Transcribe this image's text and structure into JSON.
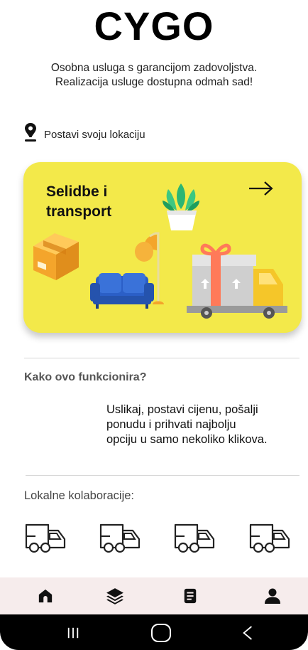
{
  "app": {
    "logo": "CYGO"
  },
  "header": {
    "tagline_line1": "Osobna usluga s garancijom zadovoljstva.",
    "tagline_line2": "Realizacija usluge dostupna odmah sad!"
  },
  "location": {
    "label": "Postavi svoju lokaciju"
  },
  "service_card": {
    "title_line1": "Selidbe i",
    "title_line2": "transport",
    "color": "#f3e94a"
  },
  "how_it_works": {
    "title": "Kako ovo funkcionira?",
    "desc_line1": "Uslikaj, postavi cijenu, pošalji",
    "desc_line2": "ponudu i prihvati najbolju",
    "desc_line3": "opciju u samo nekoliko klikova."
  },
  "collaborations": {
    "title": "Lokalne kolaboracije:",
    "items": [
      "truck-icon",
      "truck-icon",
      "truck-icon",
      "truck-icon"
    ]
  },
  "tabbar": {
    "items": [
      "home-icon",
      "layers-icon",
      "document-icon",
      "profile-icon"
    ],
    "background": "#f6ecec"
  },
  "system_nav": {
    "items": [
      "recent-apps-icon",
      "home-circle-icon",
      "back-icon"
    ]
  }
}
